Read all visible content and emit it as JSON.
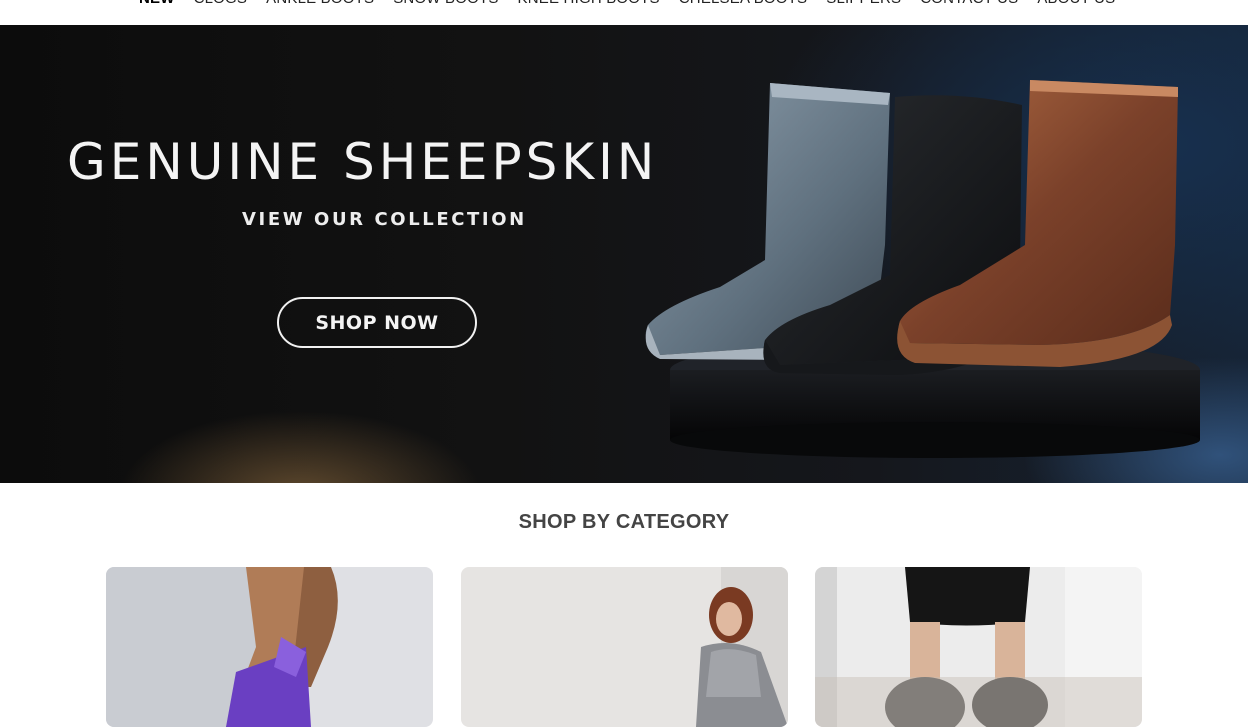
{
  "nav": {
    "items": [
      {
        "label": "NEW",
        "active": true
      },
      {
        "label": "CLOGS",
        "active": false
      },
      {
        "label": "ANKLE BOOTS",
        "active": false
      },
      {
        "label": "SNOW BOOTS",
        "active": false
      },
      {
        "label": "KNEE HIGH BOOTS",
        "active": false
      },
      {
        "label": "CHELSEA BOOTS",
        "active": false
      },
      {
        "label": "SLIPPERS",
        "active": false
      },
      {
        "label": "CONTACT US",
        "active": false
      },
      {
        "label": "ABOUT US",
        "active": false
      }
    ]
  },
  "hero": {
    "title": "GENUINE SHEEPSKIN",
    "subtitle": "VIEW OUR COLLECTION",
    "cta_label": "SHOP NOW",
    "image_icon": "sheepskin-boots-image"
  },
  "categories": {
    "title": "SHOP BY CATEGORY",
    "cards": [
      {
        "icon": "purple-boot-image",
        "accent": "#6a3fc2"
      },
      {
        "icon": "woman-seated-image",
        "accent": "#8a8a8a"
      },
      {
        "icon": "fur-boot-image",
        "accent": "#3a3a3a"
      }
    ]
  },
  "colors": {
    "hero_text": "#f4f4f4",
    "section_title": "#444444",
    "nav_text": "#222222"
  }
}
